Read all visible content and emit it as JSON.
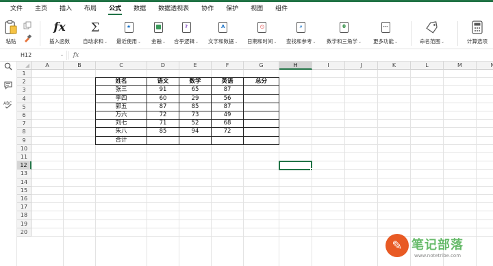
{
  "menu": {
    "tabs": [
      "文件",
      "主页",
      "插入",
      "布局",
      "公式",
      "数据",
      "数据透视表",
      "协作",
      "保护",
      "视图",
      "组件"
    ],
    "active_index": 4
  },
  "ribbon": {
    "paste": "粘贴",
    "insert_function": "插入函数",
    "autosum": "自动求和",
    "recent": "最近使用",
    "financial": "金融",
    "logical": "合乎逻辑",
    "text": "文字和数据",
    "datetime": "日期和时间",
    "lookup": "查找和参考",
    "math": "数学和三角学",
    "more": "更多功能",
    "name_range": "命名范围",
    "calc_options": "计算选项"
  },
  "formula_bar": {
    "name_box": "H12",
    "fx": "fx",
    "content": ""
  },
  "sheet": {
    "columns": [
      "A",
      "B",
      "C",
      "D",
      "E",
      "F",
      "G",
      "H",
      "I",
      "J",
      "K",
      "L",
      "M",
      "N"
    ],
    "rows": [
      "1",
      "2",
      "3",
      "4",
      "5",
      "6",
      "7",
      "8",
      "9",
      "10",
      "11",
      "12",
      "13",
      "14",
      "15",
      "16",
      "17",
      "18",
      "19",
      "20"
    ],
    "selected_cell": "H12",
    "table": {
      "headers": [
        "姓名",
        "语文",
        "数学",
        "英语",
        "总分"
      ],
      "rows": [
        [
          "张三",
          "91",
          "65",
          "87",
          ""
        ],
        [
          "李四",
          "60",
          "29",
          "56",
          ""
        ],
        [
          "郭五",
          "87",
          "85",
          "87",
          ""
        ],
        [
          "万六",
          "72",
          "73",
          "49",
          ""
        ],
        [
          "刘七",
          "71",
          "52",
          "68",
          ""
        ],
        [
          "朱八",
          "85",
          "94",
          "72",
          ""
        ],
        [
          "合计",
          "",
          "",
          "",
          ""
        ]
      ]
    }
  },
  "watermark": {
    "text": "笔记部落",
    "url": "www.notetribe.com"
  },
  "colors": {
    "accent": "#217346",
    "logo": "#e85a24"
  }
}
